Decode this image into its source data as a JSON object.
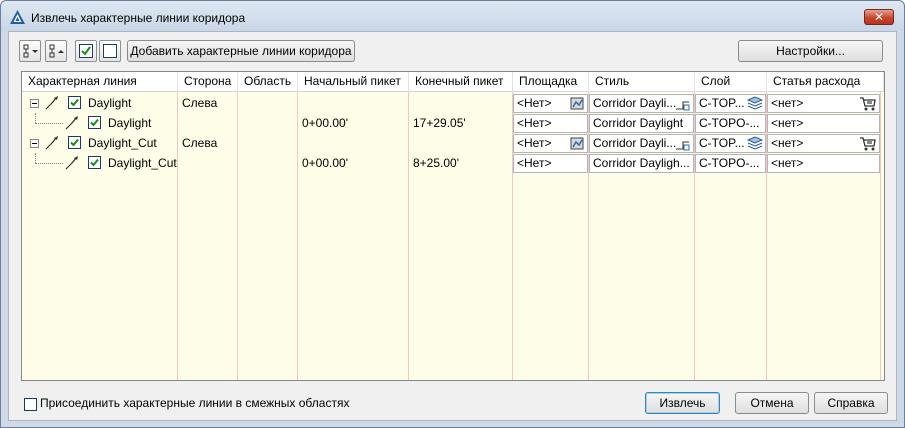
{
  "window": {
    "title": "Извлечь характерные линии коридора",
    "close_label": "✕"
  },
  "toolbar": {
    "add_button_label": "Добавить характерные линии коридора",
    "settings_button_label": "Настройки..."
  },
  "grid": {
    "columns": [
      "Характерная линия",
      "Сторона",
      "Область",
      "Начальный пикет",
      "Конечный пикет",
      "Площадка",
      "Стиль",
      "Слой",
      "Статья расхода"
    ],
    "rows": [
      {
        "name": "Daylight",
        "side": "Слева",
        "region": "",
        "start": "",
        "end": "",
        "site": "<Нет>",
        "style": "Corridor Dayli...",
        "layer": "C-TOP...",
        "pay_item": "<нет>",
        "level": 0,
        "checked": true,
        "editable": true
      },
      {
        "name": "Daylight",
        "side": "",
        "region": "",
        "start": "0+00.00'",
        "end": "17+29.05'",
        "site": "<Нет>",
        "style": "Corridor Daylight",
        "layer": "C-TOPO-...",
        "pay_item": "<нет>",
        "level": 1,
        "checked": true,
        "editable": false
      },
      {
        "name": "Daylight_Cut",
        "side": "Слева",
        "region": "",
        "start": "",
        "end": "",
        "site": "<Нет>",
        "style": "Corridor Dayli...",
        "layer": "C-TOP...",
        "pay_item": "<нет>",
        "level": 0,
        "checked": true,
        "editable": true
      },
      {
        "name": "Daylight_Cut",
        "side": "",
        "region": "",
        "start": "0+00.00'",
        "end": "8+25.00'",
        "site": "<Нет>",
        "style": "Corridor Dayligh...",
        "layer": "C-TOPO-...",
        "pay_item": "<нет>",
        "level": 1,
        "checked": true,
        "editable": false
      }
    ]
  },
  "footer": {
    "join_label": "Присоединить характерные линии в смежных областях",
    "join_checked": false,
    "extract_label": "Извлечь",
    "cancel_label": "Отмена",
    "help_label": "Справка"
  },
  "colors": {
    "title_bar": "#cfd9e6",
    "grid_background": "#fefde8",
    "column_separator": "#f1c6c6",
    "close_button": "#c8462e"
  }
}
